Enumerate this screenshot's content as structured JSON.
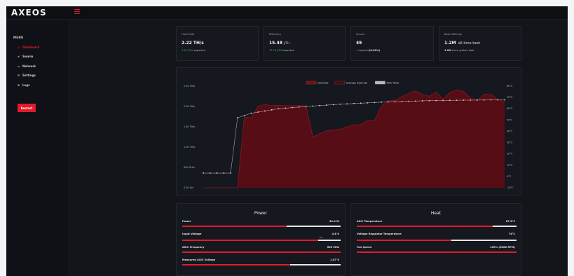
{
  "app": {
    "logo": "AXEOS"
  },
  "sidebar": {
    "title": "MENU",
    "items": [
      {
        "label": "Dashboard",
        "icon": "home-icon",
        "glyph": "⌂",
        "active": true
      },
      {
        "label": "Swarm",
        "icon": "share-icon",
        "glyph": "≺",
        "active": false
      },
      {
        "label": "Network",
        "icon": "wifi-icon",
        "glyph": "≈",
        "active": false
      },
      {
        "label": "Settings",
        "icon": "gear-icon",
        "glyph": "✲",
        "active": false
      },
      {
        "label": "Logs",
        "icon": "list-icon",
        "glyph": "≡",
        "active": false
      }
    ],
    "restart_label": "Restart"
  },
  "stats": {
    "hashrate": {
      "label": "Hash Rate",
      "value": "2.22 TH/s",
      "sub_value": "1.54 TH/s",
      "sub_text": "expected"
    },
    "efficiency": {
      "label": "Efficiency",
      "value": "15.48",
      "unit": "J/TH",
      "sub_value": "17.74 J/TH",
      "sub_text": "expected"
    },
    "shares": {
      "label": "Shares",
      "value": "49",
      "sub_value": "0",
      "sub_text": "rejected",
      "sub_pct": "(0.00%)"
    },
    "difficulty": {
      "label": "Best Difficulty",
      "value": "1.2M",
      "value_suffix": "all-time best",
      "sub_value": "1.2M",
      "sub_text": "since system boot"
    }
  },
  "chart_data": {
    "type": "line",
    "legend": [
      "Hashrate",
      "Average Hashrate",
      "ASIC Temp"
    ],
    "legend_colors": [
      "#6b0f18",
      "#3a0d12",
      "#b8b8b8"
    ],
    "y_left_ticks": [
      "0.00 H/s",
      "500 GH/s",
      "1.00 TH/s",
      "1.50 TH/s",
      "2.00 TH/s",
      "2.50 TH/s"
    ],
    "y_right_ticks": [
      "60°C",
      "70°C",
      "60°C",
      "50°C",
      "40°C",
      "30°C",
      "20°C",
      "10°C",
      "0°C",
      "-10°C"
    ],
    "ylim_left": [
      0,
      2.5
    ],
    "ylim_right": [
      -10,
      80
    ],
    "hashrate_ths": [
      0,
      0,
      0,
      0,
      0,
      0,
      1.74,
      1.72,
      2.0,
      2.05,
      2.02,
      2.03,
      2.02,
      2.02,
      2.02,
      2.01,
      1.25,
      1.33,
      1.4,
      1.42,
      1.44,
      1.5,
      1.55,
      1.55,
      1.65,
      1.65,
      2.0,
      2.14,
      2.15,
      2.24,
      2.32,
      2.38,
      2.3,
      2.25,
      2.35,
      2.18,
      2.34,
      2.4,
      2.37,
      2.21,
      2.14,
      2.3,
      2.3,
      2.16,
      2.12
    ],
    "avg_temp_c": [
      3,
      3,
      3,
      3,
      3,
      52,
      54,
      56,
      57,
      58,
      59,
      60,
      60.5,
      61,
      61.5,
      62,
      62.4,
      62.8,
      63.2,
      63.6,
      64,
      64.3,
      64.6,
      64.9,
      65.2,
      65.5,
      65.8,
      66,
      66.2,
      66.4,
      66.6,
      66.8,
      67,
      67.1,
      67.2,
      67.3,
      67.4,
      67.5,
      67.6,
      67.6,
      67.7,
      67.7,
      67.8,
      67.8,
      67.8
    ]
  },
  "power": {
    "title": "Power",
    "rows": [
      {
        "label": "Power",
        "value": "34.4 W",
        "fill": 0.66
      },
      {
        "label": "Input Voltage",
        "value": "4.8 V",
        "fill": 0.86,
        "marker": "5.0"
      },
      {
        "label": "ASIC Frequency",
        "value": "550 MHz",
        "fill": 1.0
      },
      {
        "label": "Measured ASIC Voltage",
        "value": "1.07 V",
        "fill": 0.68
      }
    ]
  },
  "heat": {
    "title": "Heat",
    "rows": [
      {
        "label": "ASIC Temperature",
        "value": "67.3°C",
        "fill": 0.85
      },
      {
        "label": "Voltage Regulator Temperature",
        "value": "74°C",
        "fill": 0.59
      },
      {
        "label": "Fan Speed",
        "value": "100% (6580 RPM)",
        "fill": 1.0
      }
    ]
  }
}
